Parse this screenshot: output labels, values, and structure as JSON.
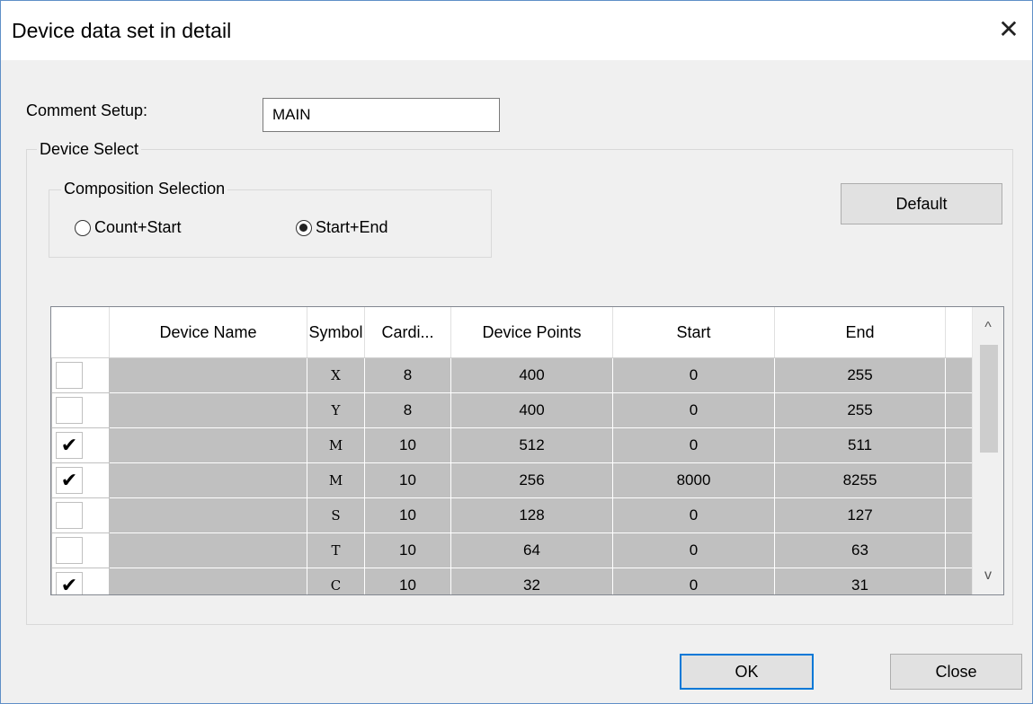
{
  "window": {
    "title": "Device data set in detail",
    "close_glyph": "✕"
  },
  "comment": {
    "label": "Comment Setup:",
    "value": "MAIN"
  },
  "device_select": {
    "title": "Device Select",
    "composition": {
      "title": "Composition Selection",
      "options": [
        {
          "label": "Count+Start",
          "selected": false
        },
        {
          "label": "Start+End",
          "selected": true
        }
      ]
    },
    "default_label": "Default"
  },
  "table": {
    "columns": [
      "",
      "Device Name",
      "Symbol",
      "Cardi...",
      "Device Points",
      "Start",
      "End"
    ],
    "rows": [
      {
        "checked": false,
        "name": "",
        "symbol": "X",
        "cardinal": "8",
        "points": "400",
        "start": "0",
        "end": "255"
      },
      {
        "checked": false,
        "name": "",
        "symbol": "Y",
        "cardinal": "8",
        "points": "400",
        "start": "0",
        "end": "255"
      },
      {
        "checked": true,
        "name": "",
        "symbol": "M",
        "cardinal": "10",
        "points": "512",
        "start": "0",
        "end": "511"
      },
      {
        "checked": true,
        "name": "",
        "symbol": "M",
        "cardinal": "10",
        "points": "256",
        "start": "8000",
        "end": "8255"
      },
      {
        "checked": false,
        "name": "",
        "symbol": "S",
        "cardinal": "10",
        "points": "128",
        "start": "0",
        "end": "127"
      },
      {
        "checked": false,
        "name": "",
        "symbol": "T",
        "cardinal": "10",
        "points": "64",
        "start": "0",
        "end": "63"
      },
      {
        "checked": true,
        "name": "",
        "symbol": "C",
        "cardinal": "10",
        "points": "32",
        "start": "0",
        "end": "31"
      }
    ],
    "check_glyph": "✔",
    "scroll_up_glyph": "^",
    "scroll_down_glyph": "v"
  },
  "buttons": {
    "ok": "OK",
    "close": "Close"
  }
}
